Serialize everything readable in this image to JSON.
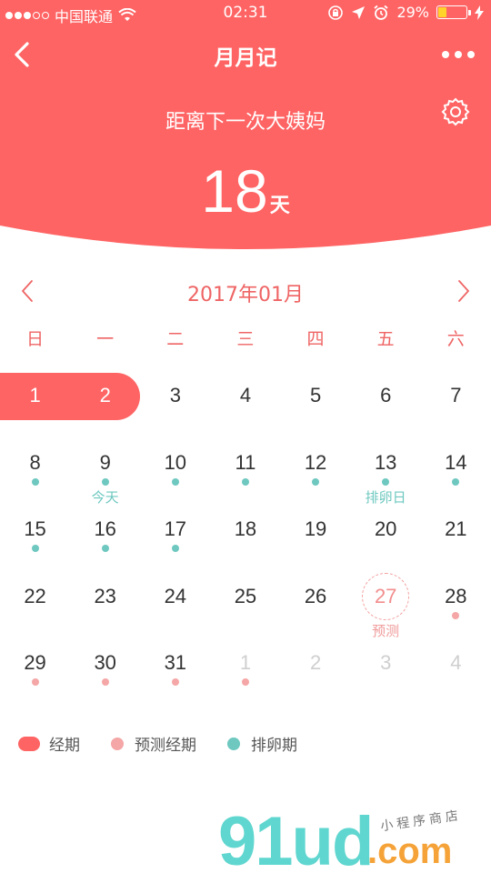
{
  "status_bar": {
    "carrier": "中国联通",
    "time": "02:31",
    "battery_percent": "29%",
    "battery_level": 0.29,
    "battery_color": "#ffd32a"
  },
  "nav": {
    "title": "月月记",
    "back_icon": "chevron-left-icon",
    "more_icon": "more-dots-icon"
  },
  "countdown": {
    "label": "距离下一次大姨妈",
    "days": "18",
    "unit": "天"
  },
  "calendar": {
    "month_title": "2017年01月",
    "weekdays": [
      "日",
      "一",
      "二",
      "三",
      "四",
      "五",
      "六"
    ],
    "weeks": [
      [
        {
          "day": "1",
          "type": "period"
        },
        {
          "day": "2",
          "type": "period"
        },
        {
          "day": "3"
        },
        {
          "day": "4"
        },
        {
          "day": "5"
        },
        {
          "day": "6"
        },
        {
          "day": "7"
        }
      ],
      [
        {
          "day": "8",
          "dot": "ovulation"
        },
        {
          "day": "9",
          "dot": "ovulation",
          "label": "今天",
          "label_color": "teal"
        },
        {
          "day": "10",
          "dot": "ovulation"
        },
        {
          "day": "11",
          "dot": "ovulation"
        },
        {
          "day": "12",
          "dot": "ovulation"
        },
        {
          "day": "13",
          "dot": "ovulation",
          "label": "排卵日",
          "label_color": "teal"
        },
        {
          "day": "14",
          "dot": "ovulation"
        }
      ],
      [
        {
          "day": "15",
          "dot": "ovulation"
        },
        {
          "day": "16",
          "dot": "ovulation"
        },
        {
          "day": "17",
          "dot": "ovulation"
        },
        {
          "day": "18"
        },
        {
          "day": "19"
        },
        {
          "day": "20"
        },
        {
          "day": "21"
        }
      ],
      [
        {
          "day": "22"
        },
        {
          "day": "23"
        },
        {
          "day": "24"
        },
        {
          "day": "25"
        },
        {
          "day": "26"
        },
        {
          "day": "27",
          "type": "predict",
          "label": "预测",
          "label_color": "pink"
        },
        {
          "day": "28",
          "dot": "predicted"
        }
      ],
      [
        {
          "day": "29",
          "dot": "predicted"
        },
        {
          "day": "30",
          "dot": "predicted"
        },
        {
          "day": "31",
          "dot": "predicted"
        },
        {
          "day": "1",
          "type": "muted",
          "dot": "predicted"
        },
        {
          "day": "2",
          "type": "muted"
        },
        {
          "day": "3",
          "type": "muted"
        },
        {
          "day": "4",
          "type": "muted"
        }
      ]
    ]
  },
  "legend": [
    {
      "label": "经期",
      "shape": "pill",
      "color": "#ff6464"
    },
    {
      "label": "预测经期",
      "shape": "dot",
      "color": "#f5a6a6"
    },
    {
      "label": "排卵期",
      "shape": "dot",
      "color": "#6ec8c0"
    }
  ],
  "colors": {
    "accent": "#ff6464",
    "ovulation": "#6ec8c0",
    "predicted": "#f5a6a6"
  },
  "watermark": {
    "logo": "91ud",
    "domain": ".com",
    "tagline": "小程序商店"
  }
}
